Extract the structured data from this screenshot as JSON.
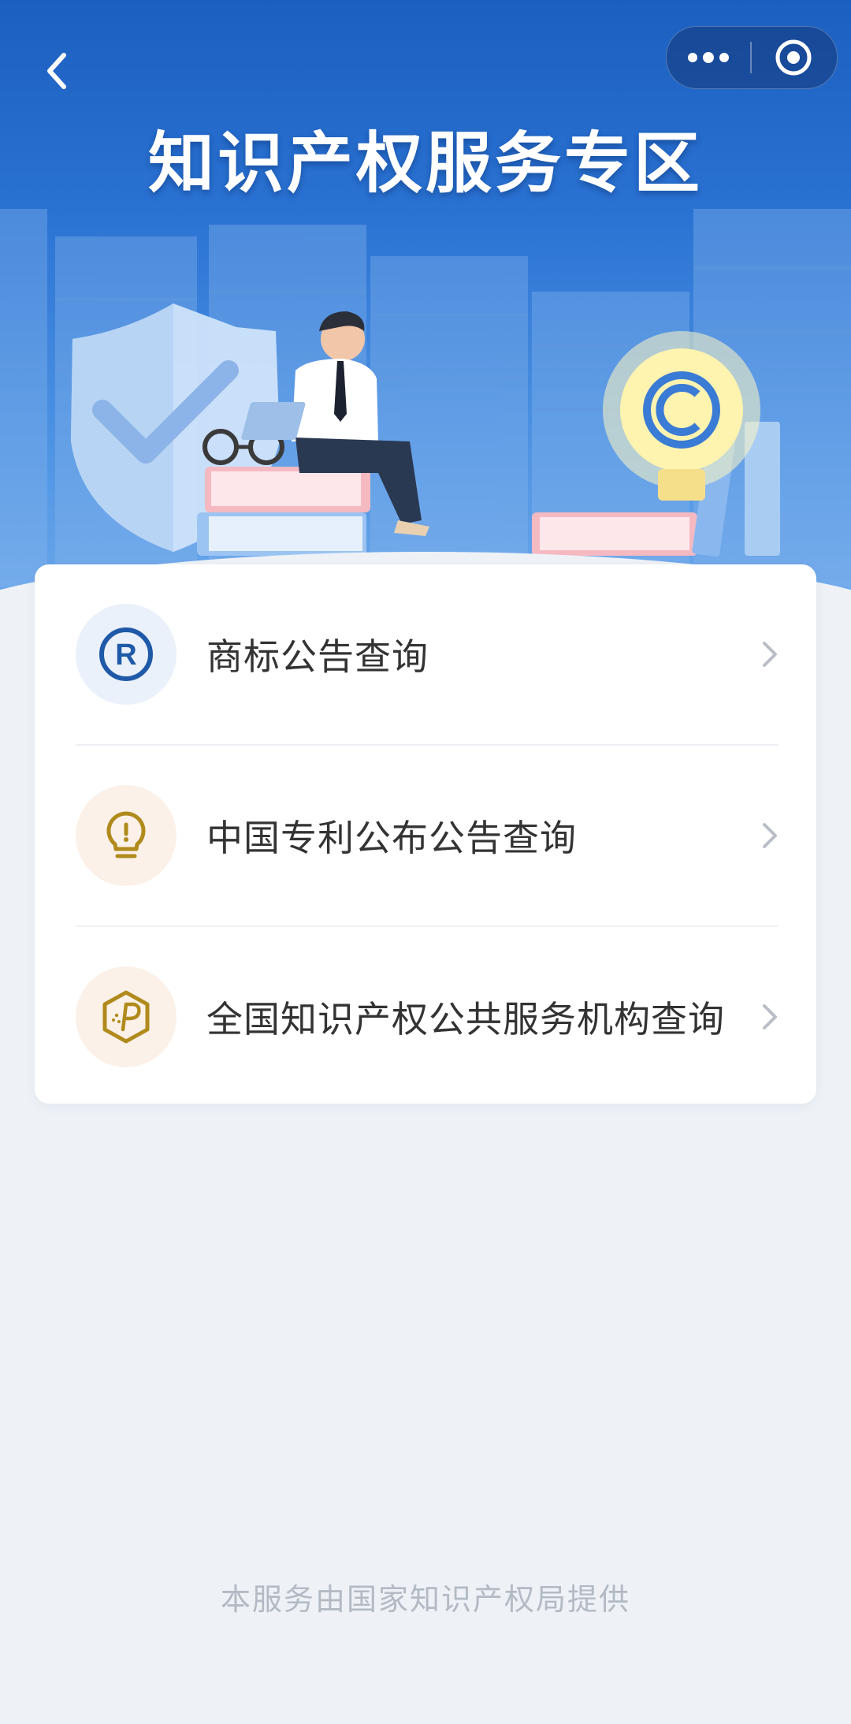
{
  "header": {
    "title": "知识产权服务专区",
    "back_icon": "chevron-left-icon",
    "more_icon": "more-dots-icon",
    "close_icon": "target-circle-icon"
  },
  "menu": {
    "items": [
      {
        "label": "商标公告查询",
        "icon": "registered-trademark-icon",
        "icon_color": "#1f5aa8",
        "icon_bg": "#eaf1fa"
      },
      {
        "label": "中国专利公布公告查询",
        "icon": "lightbulb-icon",
        "icon_color": "#b08a1c",
        "icon_bg": "#fbf1e8"
      },
      {
        "label": "全国知识产权公共服务机构查询",
        "icon": "hexagon-ip-icon",
        "icon_color": "#b08a1c",
        "icon_bg": "#fbf1e8"
      }
    ]
  },
  "footer": {
    "text": "本服务由国家知识产权局提供"
  },
  "colors": {
    "brand_blue": "#1c5fc0",
    "page_bg": "#eef2f7",
    "text_primary": "#333333",
    "text_muted": "#b3bac4"
  }
}
